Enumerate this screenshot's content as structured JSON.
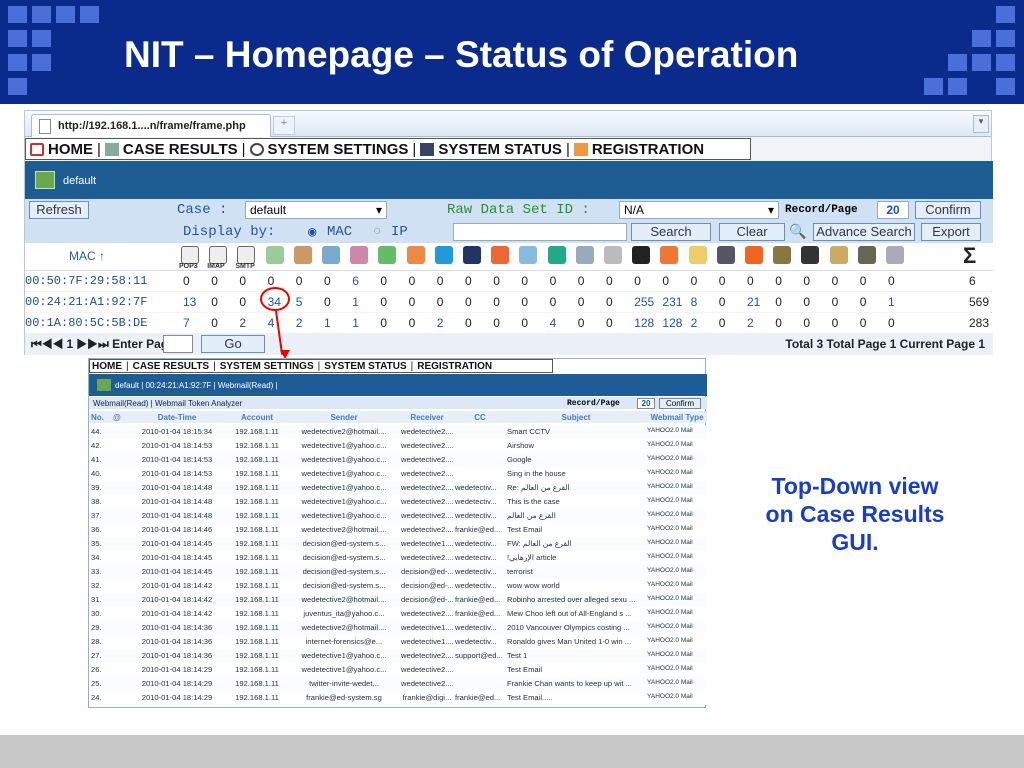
{
  "slide_title": "NIT – Homepage – Status of Operation",
  "caption": [
    "Top-Down view",
    "on Case Results",
    "GUI."
  ],
  "browser": {
    "tab_title": "http://192.168.1....n/frame/frame.php",
    "new_tab": "+",
    "scroll": "▾"
  },
  "nav": {
    "home": "HOME",
    "case_results": "CASE RESULTS",
    "system_settings": "SYSTEM SETTINGS",
    "system_status": "SYSTEM STATUS",
    "registration": "REGISTRATION",
    "sep": "|"
  },
  "case_bar": {
    "label": "default"
  },
  "filter": {
    "refresh": "Refresh",
    "case_label": "Case :",
    "case_value": "default",
    "raw_label": "Raw Data Set ID :",
    "raw_value": "N/A",
    "record_label": "Record/Page",
    "record_value": "20",
    "confirm": "Confirm"
  },
  "display": {
    "label": "Display by:",
    "mac": "MAC",
    "ip": "IP",
    "search": "Search",
    "clear": "Clear",
    "advance": "Advance Search",
    "export": "Export"
  },
  "table": {
    "mac_header": "MAC ↑",
    "sigma": "Σ",
    "icon_caps": [
      "POP3",
      "IMAP",
      "SMTP"
    ],
    "rows": [
      {
        "mac": "00:50:7F:29:58:11",
        "vals": [
          "0",
          "0",
          "0",
          "0",
          "0",
          "0",
          "6",
          "0",
          "0",
          "0",
          "0",
          "0",
          "0",
          "0",
          "0",
          "0",
          "0",
          "0",
          "0",
          "0",
          "0",
          "0",
          "0",
          "0",
          "0",
          "0",
          "6"
        ]
      },
      {
        "mac": "00:24:21:A1:92:7F",
        "vals": [
          "13",
          "0",
          "0",
          "34",
          "5",
          "0",
          "1",
          "0",
          "0",
          "0",
          "0",
          "0",
          "0",
          "0",
          "0",
          "0",
          "255",
          "231",
          "8",
          "0",
          "21",
          "0",
          "0",
          "0",
          "0",
          "1",
          "569"
        ]
      },
      {
        "mac": "00:1A:80:5C:5B:DE",
        "vals": [
          "7",
          "0",
          "2",
          "4",
          "2",
          "1",
          "1",
          "0",
          "0",
          "2",
          "0",
          "0",
          "0",
          "4",
          "0",
          "0",
          "128",
          "128",
          "2",
          "0",
          "2",
          "0",
          "0",
          "0",
          "0",
          "0",
          "283"
        ]
      }
    ]
  },
  "pager": {
    "nav": "⏮◀◀ 1 ▶▶⏭ Enter Page",
    "go": "Go",
    "summary": "Total 3  Total Page 1  Current Page 1"
  },
  "inner": {
    "nav_home": "HOME",
    "nav_case": "CASE RESULTS",
    "nav_sys": "SYSTEM SETTINGS",
    "nav_status": "SYSTEM STATUS",
    "nav_reg": "REGISTRATION",
    "bar": "default | 00:24:21:A1:92:7F | Webmail(Read) |",
    "sub": "Webmail(Read)  |  Webmail Token Analyzer",
    "record_label": "Record/Page",
    "record_value": "20",
    "confirm": "Confirm",
    "headers": [
      "No.",
      "@",
      "Date-Time",
      "Account",
      "Sender",
      "Receiver",
      "CC",
      "Subject",
      "Webmail Type"
    ],
    "rows": [
      [
        "44.",
        "",
        "2010-01-04 18:15:34",
        "192.168.1.11",
        "wedetective2@hotmail....",
        "wedetective2....",
        "",
        "Smart CCTV",
        "YAHOO2.0 Mail"
      ],
      [
        "42.",
        "",
        "2010-01-04 18:14:53",
        "192.168.1.11",
        "wedetective1@yahoo.c...",
        "wedetective2....",
        "",
        "Airshow",
        "YAHOO2.0 Mail"
      ],
      [
        "41.",
        "",
        "2010-01-04 18:14:53",
        "192.168.1.11",
        "wedetective1@yahoo.c...",
        "wedetective2....",
        "",
        "Google",
        "YAHOO2.0 Mail"
      ],
      [
        "40.",
        "",
        "2010-01-04 18:14:53",
        "192.168.1.11",
        "wedetective1@yahoo.c...",
        "wedetective2....",
        "",
        "Sing in the house",
        "YAHOO2.0 Mail"
      ],
      [
        "39.",
        "",
        "2010-01-04 18:14:48",
        "192.168.1.11",
        "wedetective1@yahoo.c...",
        "wedetective2....",
        "wedetectiv...",
        "Re: القرع من العالم",
        "YAHOO2.0 Mail"
      ],
      [
        "38.",
        "",
        "2010-01-04 18:14:48",
        "192.168.1.11",
        "wedetective1@yahoo.c...",
        "wedetective2....",
        "wedetectiv...",
        "This is the case",
        "YAHOO2.0 Mail"
      ],
      [
        "37.",
        "",
        "2010-01-04 18:14:48",
        "192.168.1.11",
        "wedetective1@yahoo.c...",
        "wedetective2....",
        "wedetectiv...",
        "القرع من العالم",
        "YAHOO2.0 Mail"
      ],
      [
        "36.",
        "",
        "2010-01-04 18:14:46",
        "192.168.1.11",
        "wedetective2@hotmail....",
        "wedetective2....",
        "frankie@ed...",
        "Test Email",
        "YAHOO2.0 Mail"
      ],
      [
        "35.",
        "",
        "2010-01-04 18:14:45",
        "192.168.1.11",
        "decision@ed-system.s...",
        "wedetective1....",
        "wedetectiv...",
        "FW: القرع من العالم",
        "YAHOO2.0 Mail"
      ],
      [
        "34.",
        "",
        "2010-01-04 18:14:45",
        "192.168.1.11",
        "decision@ed-system.s...",
        "wedetective2....",
        "wedetectiv...",
        "!الإرهابي article",
        "YAHOO2.0 Mail"
      ],
      [
        "33.",
        "",
        "2010-01-04 18:14:45",
        "192.168.1.11",
        "decision@ed-system.s...",
        "decision@ed-...",
        "wedetectiv...",
        "terrorist",
        "YAHOO2.0 Mail"
      ],
      [
        "32.",
        "",
        "2010-01-04 18:14:42",
        "192.168.1.11",
        "decision@ed-system.s...",
        "decision@ed-...",
        "wedetectiv...",
        "wow wow world",
        "YAHOO2.0 Mail"
      ],
      [
        "31.",
        "",
        "2010-01-04 18:14:42",
        "192.168.1.11",
        "wedetective2@hotmail....",
        "decision@ed-...",
        "frankie@ed...",
        "Robinho arrested over alleged sexu ...",
        "YAHOO2.0 Mail"
      ],
      [
        "30.",
        "",
        "2010-01-04 18:14:42",
        "192.168.1.11",
        "juventus_ita@yahoo.c...",
        "wedetective2....",
        "frankie@ed...",
        "Mew Choo left out of All-England s ...",
        "YAHOO2.0 Mail"
      ],
      [
        "29.",
        "",
        "2010-01-04 18:14:36",
        "192.168.1.11",
        "wedetective2@hotmail....",
        "wedetective1....",
        "wedetectiv...",
        "2010 Vancouver Olympics costing ...",
        "YAHOO2.0 Mail"
      ],
      [
        "28.",
        "",
        "2010-01-04 18:14:36",
        "192.168.1.11",
        "internet-forensics@e...",
        "wedetective1....",
        "wedetectiv...",
        "Ronaldo gives Man United 1-0 win ...",
        "YAHOO2.0 Mail"
      ],
      [
        "27.",
        "",
        "2010-01-04 18:14:36",
        "192.168.1.11",
        "wedetective1@yahoo.c...",
        "wedetective2....",
        "support@ed...",
        "Test 1",
        "YAHOO2.0 Mail"
      ],
      [
        "26.",
        "",
        "2010-01-04 18:14:29",
        "192.168.1.11",
        "wedetective1@yahoo.c...",
        "wedetective2....",
        "",
        "Test Email",
        "YAHOO2.0 Mail"
      ],
      [
        "25.",
        "",
        "2010-01-04 18:14:29",
        "192.168.1.11",
        "twitter-invite-wedet...",
        "wedetective2....",
        "",
        "Frankie Chan wants to keep up wit ...",
        "YAHOO2.0 Mail"
      ],
      [
        "24.",
        "",
        "2010-01-04 18:14:29",
        "192.168.1.11",
        "frankie@ed-system.sg",
        "frankie@digi...",
        "frankie@ed...",
        "Test Email.....",
        "YAHOO2.0 Mail"
      ]
    ]
  }
}
